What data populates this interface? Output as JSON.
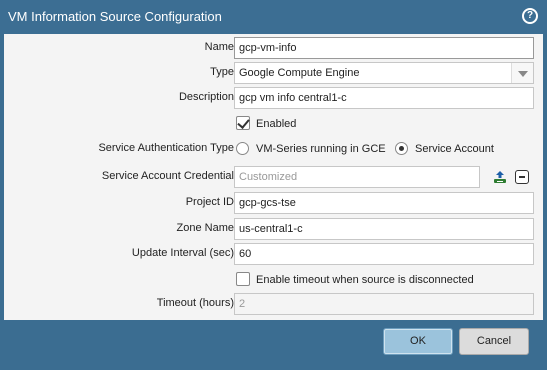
{
  "dialog": {
    "title": "VM Information Source Configuration",
    "help_icon": "question-circle-icon"
  },
  "form": {
    "name": {
      "label": "Name",
      "value": "gcp-vm-info"
    },
    "type": {
      "label": "Type",
      "value": "Google Compute Engine"
    },
    "description": {
      "label": "Description",
      "value": "gcp vm info central1-c"
    },
    "enabled": {
      "label": "Enabled",
      "checked": true
    },
    "service_auth": {
      "label": "Service Authentication Type",
      "options": [
        "VM-Series running in GCE",
        "Service Account"
      ],
      "selected": "Service Account"
    },
    "credential": {
      "label": "Service Account Credential",
      "placeholder": "Customized",
      "add_icon": "upload-icon",
      "remove_icon": "minus-box-icon"
    },
    "project_id": {
      "label": "Project ID",
      "value": "gcp-gcs-tse"
    },
    "zone_name": {
      "label": "Zone Name",
      "value": "us-central1-c"
    },
    "update_interval": {
      "label": "Update Interval (sec)",
      "value": "60"
    },
    "enable_timeout": {
      "label": "Enable timeout when source is disconnected",
      "checked": false
    },
    "timeout": {
      "label": "Timeout (hours)",
      "value": "2"
    }
  },
  "buttons": {
    "ok": "OK",
    "cancel": "Cancel"
  }
}
